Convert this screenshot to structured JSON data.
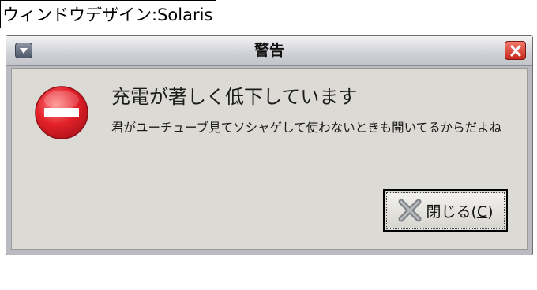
{
  "caption": "ウィンドウデザイン:Solaris",
  "window": {
    "title": "警告",
    "menu_icon": "window-menu-icon",
    "close_icon": "close-icon"
  },
  "dialog": {
    "icon": "stop-icon",
    "heading": "充電が著しく低下しています",
    "message": "君がユーチューブ見てソシャゲして使わないときも開いてるからだよね",
    "button": {
      "label_prefix": "閉じる(",
      "mnemonic": "C",
      "label_suffix": ")",
      "icon": "close-x-icon"
    }
  },
  "colors": {
    "stop_red": "#e3202a",
    "close_red": "#c8281b",
    "dialog_bg": "#dcdad5"
  }
}
